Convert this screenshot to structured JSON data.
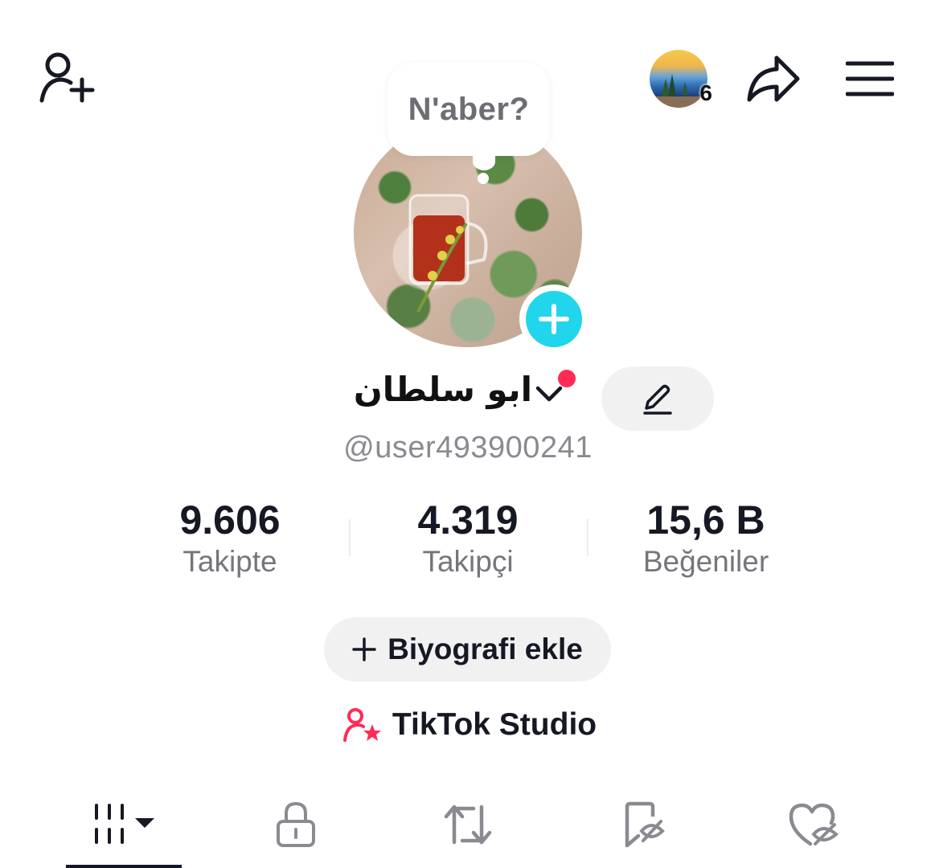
{
  "header": {
    "story": {
      "count": "6",
      "icon": "story-thumbnail-icon"
    },
    "icons": {
      "add_friend": "person-plus-icon",
      "share": "share-arrow-icon",
      "menu": "hamburger-menu-icon"
    }
  },
  "profile": {
    "note": "N'aber?",
    "display_name": "ابو سلطان",
    "username": "@user493900241",
    "add_story_icon": "plus-circle-icon",
    "edit_icon": "pencil-icon",
    "notification_dot_color": "#fe2c55"
  },
  "stats": [
    {
      "value": "9.606",
      "label": "Takipte"
    },
    {
      "value": "4.319",
      "label": "Takipçi"
    },
    {
      "value": "15,6 B",
      "label": "Beğeniler"
    }
  ],
  "bio_button": {
    "icon": "+",
    "label": "Biyografi ekle"
  },
  "studio": {
    "label": "TikTok Studio",
    "icon": "creator-star-icon",
    "icon_color": "#fe2c55"
  },
  "tabs": {
    "items": [
      {
        "icon": "video-grid-icon",
        "active": true
      },
      {
        "icon": "lock-icon",
        "active": false
      },
      {
        "icon": "repost-icon",
        "active": false
      },
      {
        "icon": "bookmark-hidden-icon",
        "active": false
      },
      {
        "icon": "heart-hidden-icon",
        "active": false
      }
    ]
  },
  "colors": {
    "accent_cyan": "#20d5ec",
    "accent_red": "#fe2c55",
    "text_primary": "#161823",
    "text_secondary": "#75767b",
    "pill_bg": "#f1f1f2"
  }
}
